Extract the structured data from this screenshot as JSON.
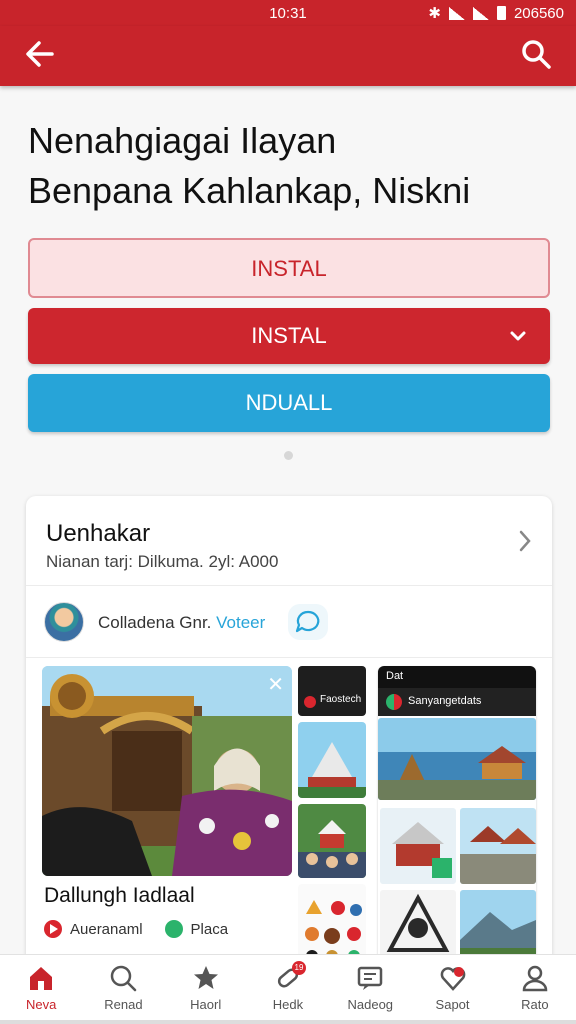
{
  "status_bar": {
    "time": "10:31",
    "right_text": "206560"
  },
  "page": {
    "title_line1": "Nenahgiagai Ilayan",
    "title_line2": "Benpana Kahlankap, Niskni"
  },
  "buttons": {
    "install_outline": "INSTAL",
    "install_primary": "INSTAL",
    "secondary": "NDUALL"
  },
  "card": {
    "title": "Uenhakar",
    "subtitle": "Nianan tarj: Dilkuma. 2yl: A000",
    "author_name": "Colladena Gnr.",
    "author_action": "Voteer",
    "photo_caption": "Dallungh Iadlaal",
    "tag_video": "Aueranaml",
    "tag_place": "Placa",
    "thumb_label": "Faostech",
    "phone": {
      "status_left": "Dat",
      "header": "Sanyangetdats"
    }
  },
  "nav": {
    "items": [
      {
        "label": "Neva",
        "icon": "home-icon",
        "active": true
      },
      {
        "label": "Renad",
        "icon": "search-icon",
        "active": false
      },
      {
        "label": "Haorl",
        "icon": "star-icon",
        "active": false
      },
      {
        "label": "Hedk",
        "icon": "pill-icon",
        "active": false,
        "badge": "19"
      },
      {
        "label": "Nadeog",
        "icon": "message-icon",
        "active": false
      },
      {
        "label": "Sapot",
        "icon": "heart-icon",
        "active": false
      },
      {
        "label": "Rato",
        "icon": "profile-icon",
        "active": false
      }
    ]
  },
  "colors": {
    "brand_red": "#c8242b",
    "accent_blue": "#27a4d8",
    "tag_green": "#2bb36b"
  }
}
